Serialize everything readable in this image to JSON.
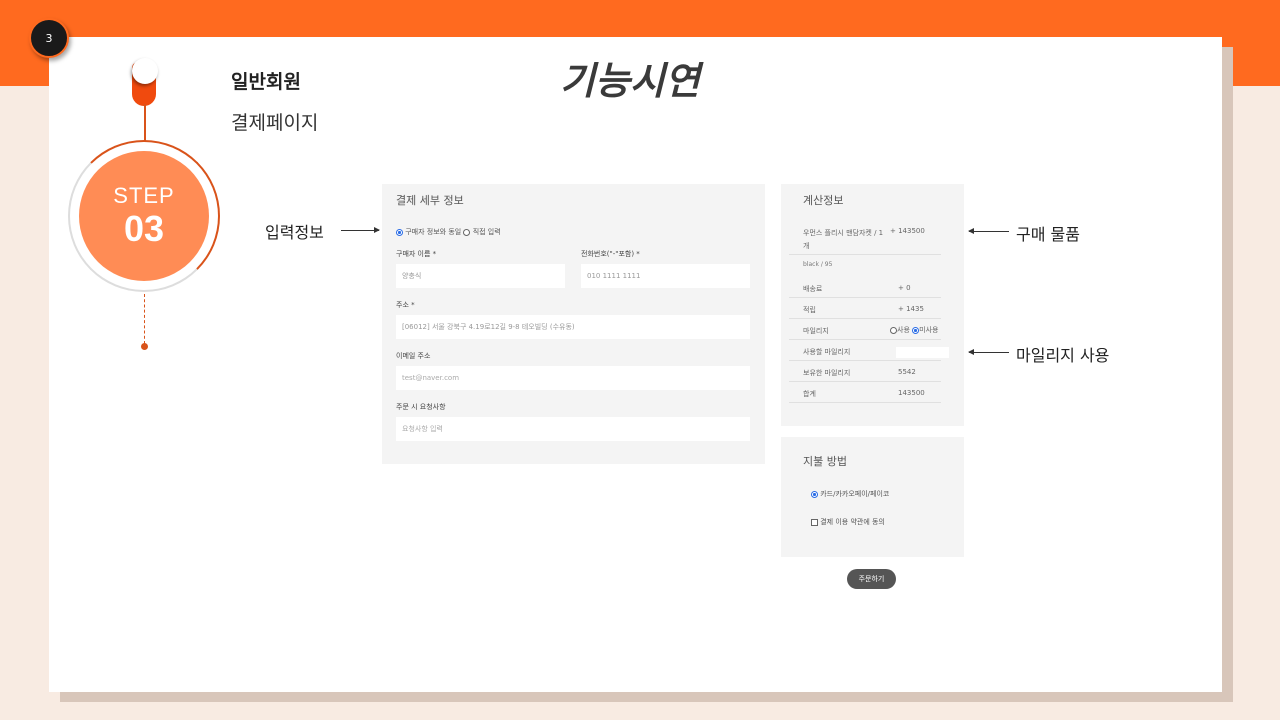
{
  "slide": {
    "page_number": "3",
    "section_title": "일반회원",
    "section_subtitle": "결제페이지",
    "main_title": "기능시연",
    "step_word": "STEP",
    "step_number": "03"
  },
  "annotations": {
    "input_info": "입력정보",
    "purchase_item": "구매 물품",
    "mileage_use": "마일리지 사용"
  },
  "checkout_detail": {
    "title": "결제 세부 정보",
    "option_same": "구매자 정보와 동일",
    "option_direct": "직접 입력",
    "buyer_name_label": "구매자 이름 *",
    "buyer_name_value": "양충식",
    "phone_label": "전화번호(\"-\"포함) *",
    "phone_value": "010 1111 1111",
    "address_label": "주소 *",
    "address_value": "[06012] 서울 강북구 4.19로12길 9-8 테오빌딩 (수유동)",
    "email_label": "이메일 주소",
    "email_placeholder": "test@naver.com",
    "request_label": "주문 시 요청사항",
    "request_placeholder": "요청사항 입력"
  },
  "calc_info": {
    "title": "계산정보",
    "product_name_line1": "우먼스 플리시 맨담자켓 / 1",
    "product_name_line2": "개",
    "product_price": "+ 143500",
    "product_option": "black / 95",
    "shipping_label": "배송료",
    "shipping_value": "+ 0",
    "points_label": "적립",
    "points_value": "+ 1435",
    "mileage_label": "마일리지",
    "mileage_use": "사용",
    "mileage_nouse": "미사용",
    "use_mileage_label": "사용할 마일리지",
    "owned_mileage_label": "보유한 마일리지",
    "owned_mileage_value": "5542",
    "total_label": "합계",
    "total_value": "143500"
  },
  "payment": {
    "title": "지불 방법",
    "option_card": "카드/카카오페이/페이코",
    "agree_label": "결제 이용 약관에 동의"
  },
  "order_button": "주문하기"
}
